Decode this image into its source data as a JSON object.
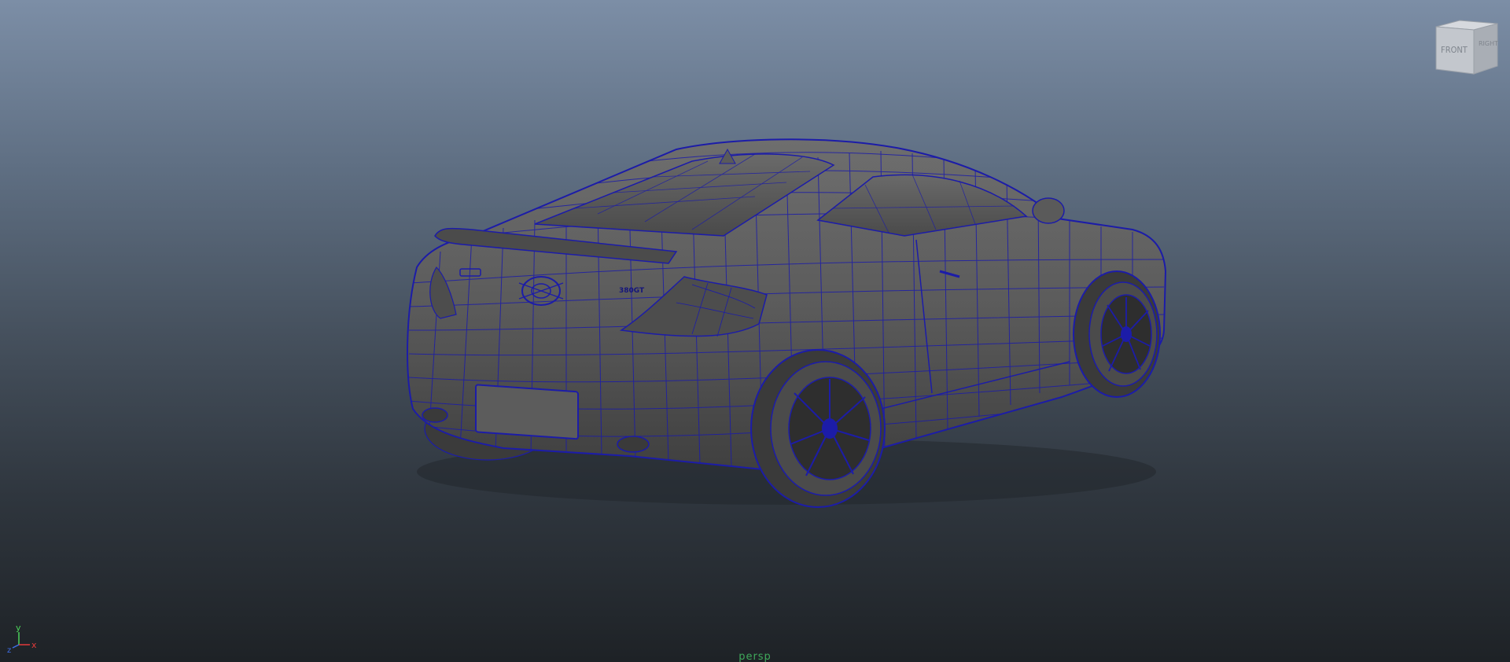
{
  "viewport": {
    "camera_name": "persp",
    "background_top": "#7c8ea6",
    "background_bottom": "#1e2226"
  },
  "viewcube": {
    "front_face_label": "FRONT",
    "right_face_label": "RIGHT"
  },
  "axis_gizmo": {
    "x_label": "x",
    "y_label": "y",
    "z_label": "z",
    "x_color": "#e23a3a",
    "y_color": "#4bd35a",
    "z_color": "#3e6ee8"
  },
  "model": {
    "name": "car-wireframe-model",
    "wireframe_color": "#1c1ca8",
    "shading_color": "#5e5e5e",
    "trunk_badge": "380GT"
  }
}
